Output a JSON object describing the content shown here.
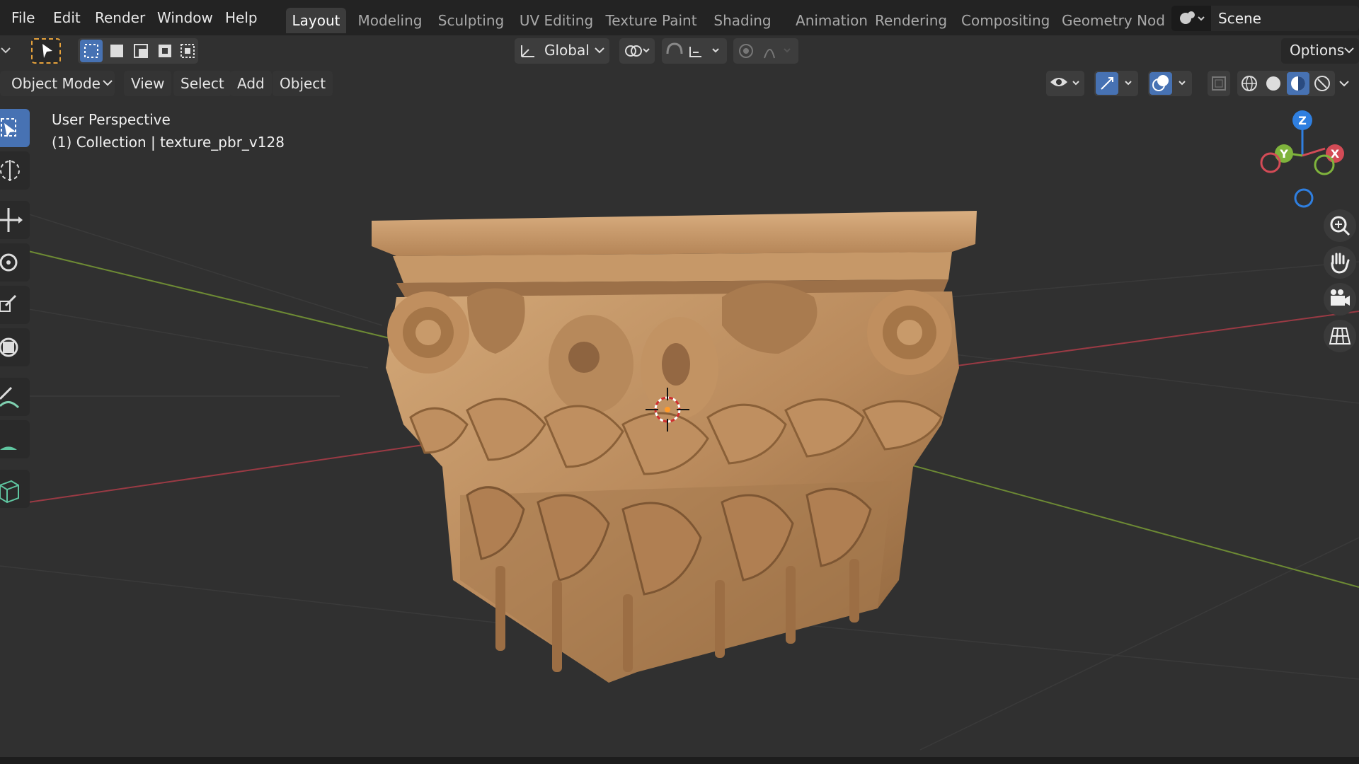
{
  "menus": [
    "File",
    "Edit",
    "Render",
    "Window",
    "Help"
  ],
  "workspaces": [
    "Layout",
    "Modeling",
    "Sculpting",
    "UV Editing",
    "Texture Paint",
    "Shading",
    "Animation",
    "Rendering",
    "Compositing",
    "Geometry Nod"
  ],
  "active_workspace": "Layout",
  "scene": {
    "name": "Scene"
  },
  "toolheader": {
    "transform_orientation": "Global",
    "options_label": "Options"
  },
  "viewheader": {
    "mode": "Object Mode",
    "menus": [
      "View",
      "Select",
      "Add",
      "Object"
    ]
  },
  "viewport": {
    "perspective": "User Perspective",
    "collection": "(1) Collection | texture_pbr_v128"
  },
  "gizmo": {
    "x": "X",
    "y": "Y",
    "z": "Z"
  },
  "colors": {
    "accent": "#4772b3",
    "x_axis": "#d34b56",
    "y_axis": "#7fb33c",
    "z_axis": "#2f7fe0",
    "object_wood": "#b98a5c"
  },
  "icons": {
    "left_toolbar": [
      "select-box-icon",
      "cursor-icon",
      "move-icon",
      "rotate-icon",
      "scale-icon",
      "transform-icon",
      "annotate-icon",
      "measure-icon",
      "add-cube-icon"
    ],
    "nav_buttons": [
      "zoom-icon",
      "hand-pan-icon",
      "camera-icon",
      "grid-perspective-icon"
    ]
  }
}
